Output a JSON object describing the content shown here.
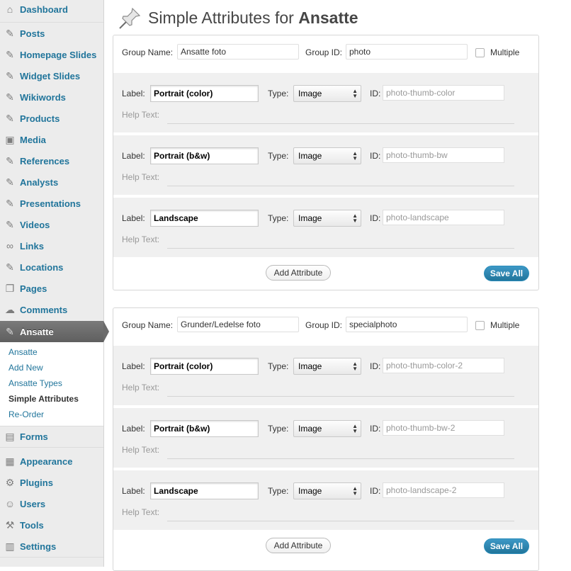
{
  "sidebar": {
    "items": [
      {
        "label": "Dashboard",
        "icon": "dashboard-icon"
      },
      {
        "label": "Posts",
        "icon": "pushpin-icon"
      },
      {
        "label": "Homepage Slides",
        "icon": "pushpin-icon"
      },
      {
        "label": "Widget Slides",
        "icon": "pushpin-icon"
      },
      {
        "label": "Wikiwords",
        "icon": "pushpin-icon"
      },
      {
        "label": "Products",
        "icon": "pushpin-icon"
      },
      {
        "label": "Media",
        "icon": "media-icon"
      },
      {
        "label": "References",
        "icon": "pushpin-icon"
      },
      {
        "label": "Analysts",
        "icon": "pushpin-icon"
      },
      {
        "label": "Presentations",
        "icon": "pushpin-icon"
      },
      {
        "label": "Videos",
        "icon": "pushpin-icon"
      },
      {
        "label": "Links",
        "icon": "link-icon"
      },
      {
        "label": "Locations",
        "icon": "pushpin-icon"
      },
      {
        "label": "Pages",
        "icon": "pages-icon"
      },
      {
        "label": "Comments",
        "icon": "comment-icon"
      },
      {
        "label": "Ansatte",
        "icon": "pushpin-icon"
      },
      {
        "label": "Forms",
        "icon": "forms-icon"
      },
      {
        "label": "Appearance",
        "icon": "appearance-icon"
      },
      {
        "label": "Plugins",
        "icon": "plugin-icon"
      },
      {
        "label": "Users",
        "icon": "users-icon"
      },
      {
        "label": "Tools",
        "icon": "tools-icon"
      },
      {
        "label": "Settings",
        "icon": "settings-icon"
      }
    ],
    "submenu": [
      "Ansatte",
      "Add New",
      "Ansatte Types",
      "Simple Attributes",
      "Re-Order"
    ]
  },
  "page": {
    "title_prefix": "Simple Attributes for",
    "title_bold": "Ansatte"
  },
  "common": {
    "group_name_label": "Group Name:",
    "group_id_label": "Group ID:",
    "multiple_label": "Multiple",
    "label_label": "Label:",
    "type_label": "Type:",
    "id_label": "ID:",
    "help_text_label": "Help Text:",
    "add_attribute": "Add Attribute",
    "save_all": "Save All"
  },
  "groups": [
    {
      "name": "Ansatte foto",
      "id": "photo",
      "attributes": [
        {
          "label": "Portrait (color)",
          "type": "Image",
          "id": "photo-thumb-color"
        },
        {
          "label": "Portrait (b&w)",
          "type": "Image",
          "id": "photo-thumb-bw"
        },
        {
          "label": "Landscape",
          "type": "Image",
          "id": "photo-landscape"
        }
      ]
    },
    {
      "name": "Grunder/Ledelse foto",
      "id": "specialphoto",
      "attributes": [
        {
          "label": "Portrait (color)",
          "type": "Image",
          "id": "photo-thumb-color-2"
        },
        {
          "label": "Portrait (b&w)",
          "type": "Image",
          "id": "photo-thumb-bw-2"
        },
        {
          "label": "Landscape",
          "type": "Image",
          "id": "photo-landscape-2"
        }
      ]
    }
  ],
  "colors": {
    "link": "#21759b",
    "accent_button": "#21759b",
    "current_menu": "#6b6b6b"
  }
}
